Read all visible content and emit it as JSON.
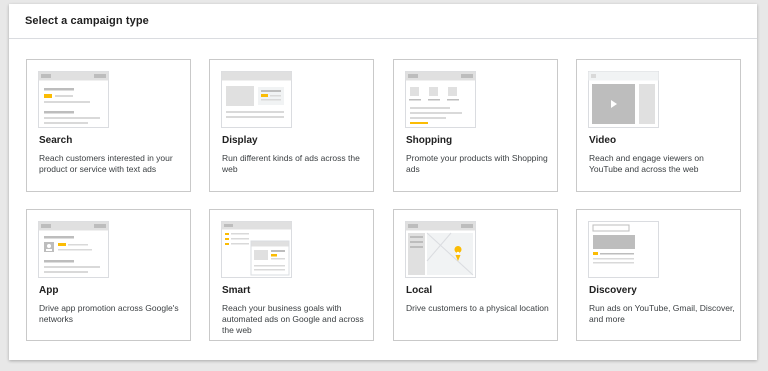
{
  "dialog": {
    "title": "Select a campaign type"
  },
  "campaign_types": [
    {
      "name": "Search",
      "description": "Reach customers interested in your product or service with text ads",
      "icon": "search-thumbnail-icon"
    },
    {
      "name": "Display",
      "description": "Run different kinds of ads across the web",
      "icon": "display-thumbnail-icon"
    },
    {
      "name": "Shopping",
      "description": "Promote your products with Shopping ads",
      "icon": "shopping-thumbnail-icon"
    },
    {
      "name": "Video",
      "description": "Reach and engage viewers on YouTube and across the web",
      "icon": "video-thumbnail-icon"
    },
    {
      "name": "App",
      "description": "Drive app promotion across Google's networks",
      "icon": "app-thumbnail-icon"
    },
    {
      "name": "Smart",
      "description": "Reach your business goals with automated ads on Google and across the web",
      "icon": "smart-thumbnail-icon"
    },
    {
      "name": "Local",
      "description": "Drive customers to a physical location",
      "icon": "local-thumbnail-icon"
    },
    {
      "name": "Discovery",
      "description": "Run ads on YouTube, Gmail, Discover, and more",
      "icon": "discovery-thumbnail-icon"
    }
  ],
  "colors": {
    "accent_yellow": "#fbbc04",
    "thumb_gray": "#d9d9d9",
    "thumb_dark": "#bdbdbd",
    "border": "#c9c9c9"
  }
}
